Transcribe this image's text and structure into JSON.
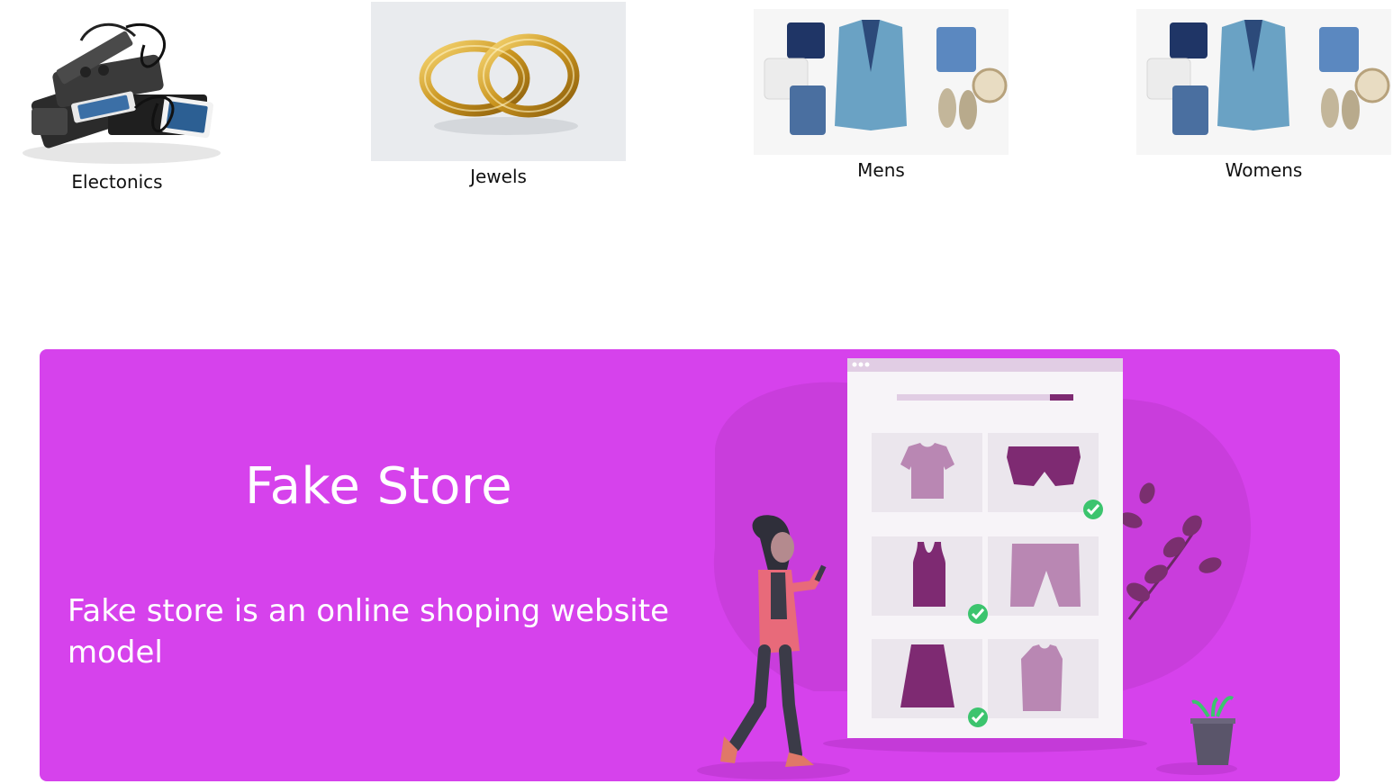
{
  "categories": [
    {
      "id": "electronics",
      "label": "Electonics",
      "icon": "electronics-image"
    },
    {
      "id": "jewels",
      "label": "Jewels",
      "icon": "rings-image"
    },
    {
      "id": "mens",
      "label": "Mens",
      "icon": "mens-clothing-image"
    },
    {
      "id": "womens",
      "label": "Womens",
      "icon": "womens-clothing-image"
    }
  ],
  "hero": {
    "title": "Fake Store",
    "subtitle": "Fake store is an online shoping website model",
    "background_color": "#d642ec",
    "accent_color": "#7e2a72",
    "illustration": "online-shopping-illustration"
  }
}
